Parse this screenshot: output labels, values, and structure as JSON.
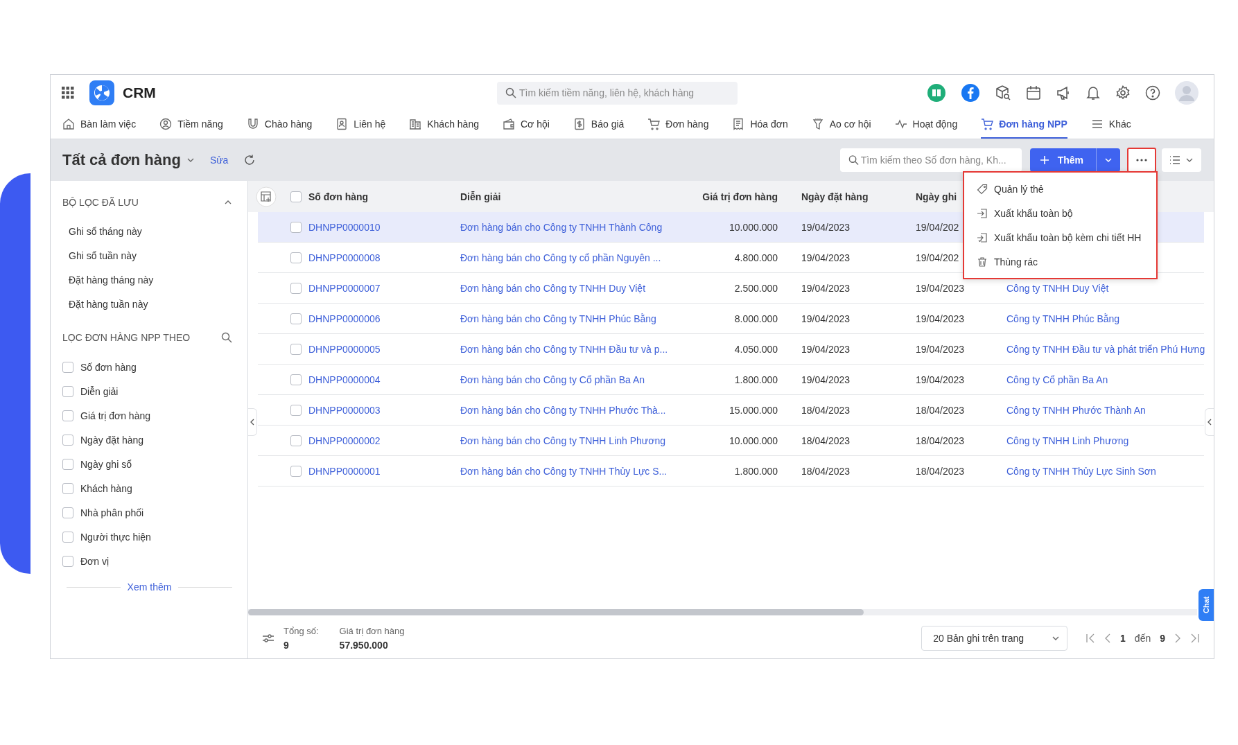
{
  "app": {
    "name": "CRM"
  },
  "search": {
    "placeholder": "Tìm kiếm tiềm năng, liên hệ, khách hàng"
  },
  "nav": [
    {
      "label": "Bàn làm việc",
      "selected": false
    },
    {
      "label": "Tiềm năng",
      "selected": false
    },
    {
      "label": "Chào hàng",
      "selected": false
    },
    {
      "label": "Liên hệ",
      "selected": false
    },
    {
      "label": "Khách hàng",
      "selected": false
    },
    {
      "label": "Cơ hội",
      "selected": false
    },
    {
      "label": "Báo giá",
      "selected": false
    },
    {
      "label": "Đơn hàng",
      "selected": false
    },
    {
      "label": "Hóa đơn",
      "selected": false
    },
    {
      "label": "Ao cơ hội",
      "selected": false
    },
    {
      "label": "Hoạt động",
      "selected": false
    },
    {
      "label": "Đơn hàng NPP",
      "selected": true
    },
    {
      "label": "Khác",
      "selected": false
    }
  ],
  "view": {
    "title": "Tất cả đơn hàng",
    "edit": "Sửa"
  },
  "table_search": {
    "placeholder": "Tìm kiếm theo Số đơn hàng, Kh..."
  },
  "add_button": {
    "label": "Thêm"
  },
  "more_menu": {
    "open": true,
    "items": [
      "Quản lý thẻ",
      "Xuất khẩu toàn bộ",
      "Xuất khẩu toàn bộ kèm chi tiết HH",
      "Thùng rác"
    ]
  },
  "sidebar": {
    "saved_filters": {
      "title": "BỘ LỌC ĐÃ LƯU",
      "expanded": true,
      "items": [
        "Ghi sổ tháng này",
        "Ghi sổ tuần này",
        "Đặt hàng tháng này",
        "Đặt hàng tuần này"
      ]
    },
    "filter_by": {
      "title": "LỌC ĐƠN HÀNG NPP THEO",
      "fields": [
        {
          "label": "Số đơn hàng",
          "checked": false
        },
        {
          "label": "Diễn giải",
          "checked": false
        },
        {
          "label": "Giá trị đơn hàng",
          "checked": false
        },
        {
          "label": "Ngày đặt hàng",
          "checked": false
        },
        {
          "label": "Ngày ghi sổ",
          "checked": false
        },
        {
          "label": "Khách hàng",
          "checked": false
        },
        {
          "label": "Nhà phân phối",
          "checked": false
        },
        {
          "label": "Người thực hiện",
          "checked": false
        },
        {
          "label": "Đơn vị",
          "checked": false
        }
      ]
    },
    "more": "Xem thêm"
  },
  "table": {
    "select_all_checked": false,
    "columns": [
      "Số đơn hàng",
      "Diễn giải",
      "Giá trị đơn hàng",
      "Ngày đặt hàng",
      "Ngày ghi"
    ],
    "rows": [
      {
        "selected": true,
        "checked": false,
        "code": "DHNPP0000010",
        "description": "Đơn hàng bán cho Công ty TNHH Thành Công",
        "value": "10.000.000",
        "order_date": "19/04/2023",
        "posted_date": "19/04/202"
      },
      {
        "selected": false,
        "checked": false,
        "code": "DHNPP0000008",
        "description": "Đơn hàng bán cho Công ty cổ phần Nguyên ...",
        "value": "4.800.000",
        "order_date": "19/04/2023",
        "posted_date": "19/04/202"
      },
      {
        "selected": false,
        "checked": false,
        "code": "DHNPP0000007",
        "description": "Đơn hàng bán cho Công ty TNHH Duy Việt",
        "value": "2.500.000",
        "order_date": "19/04/2023",
        "posted_date": "19/04/2023",
        "customer": "Công ty TNHH Duy Việt"
      },
      {
        "selected": false,
        "checked": false,
        "code": "DHNPP0000006",
        "description": "Đơn hàng bán cho Công ty TNHH Phúc Bằng",
        "value": "8.000.000",
        "order_date": "19/04/2023",
        "posted_date": "19/04/2023",
        "customer": "Công ty TNHH Phúc Bằng"
      },
      {
        "selected": false,
        "checked": false,
        "code": "DHNPP0000005",
        "description": "Đơn hàng bán cho Công ty TNHH Đầu tư và p...",
        "value": "4.050.000",
        "order_date": "19/04/2023",
        "posted_date": "19/04/2023",
        "customer": "Công ty TNHH Đầu tư và phát triển Phú Hưng"
      },
      {
        "selected": false,
        "checked": false,
        "code": "DHNPP0000004",
        "description": "Đơn hàng bán cho Công ty Cổ phần Ba An",
        "value": "1.800.000",
        "order_date": "19/04/2023",
        "posted_date": "19/04/2023",
        "customer": "Công ty Cổ phần Ba An"
      },
      {
        "selected": false,
        "checked": false,
        "code": "DHNPP0000003",
        "description": "Đơn hàng bán cho Công ty TNHH Phước Thà...",
        "value": "15.000.000",
        "order_date": "18/04/2023",
        "posted_date": "18/04/2023",
        "customer": "Công ty TNHH Phước Thành An"
      },
      {
        "selected": false,
        "checked": false,
        "code": "DHNPP0000002",
        "description": "Đơn hàng bán cho Công ty TNHH Linh Phương",
        "value": "10.000.000",
        "order_date": "18/04/2023",
        "posted_date": "18/04/2023",
        "customer": "Công ty TNHH Linh Phương"
      },
      {
        "selected": false,
        "checked": false,
        "code": "DHNPP0000001",
        "description": "Đơn hàng bán cho Công ty TNHH Thủy Lực S...",
        "value": "1.800.000",
        "order_date": "18/04/2023",
        "posted_date": "18/04/2023",
        "customer": "Công ty TNHH Thủy Lực Sinh Sơn"
      }
    ]
  },
  "footer": {
    "total_label": "Tổng số:",
    "total": "9",
    "value_label": "Giá trị đơn hàng",
    "value": "57.950.000",
    "page_size": "20 Bản ghi trên trang",
    "page": "1",
    "of": "đến",
    "pages": "9"
  },
  "chat": {
    "label": "Chat"
  }
}
